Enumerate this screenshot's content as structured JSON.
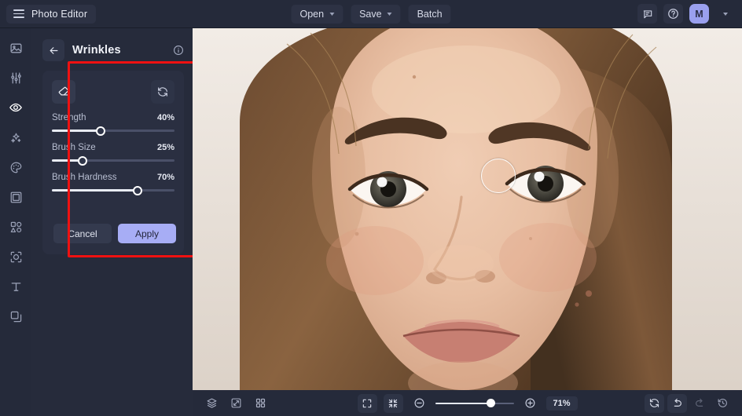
{
  "app": {
    "title": "Photo Editor",
    "menu_icon": "hamburger-icon"
  },
  "topbar": {
    "open_label": "Open",
    "save_label": "Save",
    "batch_label": "Batch",
    "feedback_icon": "comment-icon",
    "help_icon": "question-circle-icon",
    "avatar_initial": "M",
    "account_caret_icon": "chevron-down-icon"
  },
  "rail": {
    "items": [
      {
        "name": "image-icon",
        "label": "Image",
        "active": false
      },
      {
        "name": "adjust-sliders-icon",
        "label": "Adjust",
        "active": false
      },
      {
        "name": "retouch-eye-icon",
        "label": "Retouch",
        "active": true
      },
      {
        "name": "sparkles-ai-icon",
        "label": "AI Effects",
        "active": false
      },
      {
        "name": "color-palette-icon",
        "label": "Color",
        "active": false
      },
      {
        "name": "crop-frame-icon",
        "label": "Crop",
        "active": false
      },
      {
        "name": "shapes-icon",
        "label": "Shapes",
        "active": false
      },
      {
        "name": "face-detect-icon",
        "label": "Portrait",
        "active": false
      },
      {
        "name": "text-icon",
        "label": "Text",
        "active": false
      },
      {
        "name": "layers-stack-icon",
        "label": "Layers",
        "active": false
      }
    ]
  },
  "panel": {
    "back_icon": "arrow-left-icon",
    "title": "Wrinkles",
    "info_icon": "info-circle-icon",
    "eraser_icon": "eraser-icon",
    "reset_icon": "reset-refresh-icon",
    "sliders": [
      {
        "label": "Strength",
        "value": "40%",
        "percent": 40
      },
      {
        "label": "Brush Size",
        "value": "25%",
        "percent": 25
      },
      {
        "label": "Brush Hardness",
        "value": "70%",
        "percent": 70
      }
    ],
    "cancel_label": "Cancel",
    "apply_label": "Apply",
    "highlight_color": "#ef1111"
  },
  "canvas": {
    "subject": "close-up portrait of a young woman's face",
    "brush_cursor_icon": "brush-circle-cursor"
  },
  "bottombar": {
    "left_icons": [
      {
        "name": "layers-icon",
        "label": "Layers"
      },
      {
        "name": "compare-split-icon",
        "label": "Compare"
      },
      {
        "name": "grid-view-icon",
        "label": "Grid"
      }
    ],
    "fullscreen_icon": "fullscreen-icon",
    "fit-screen_icon": "fit-to-screen-icon",
    "zoom_out_icon": "zoom-out-icon",
    "zoom_in_icon": "zoom-in-icon",
    "zoom_level": "71%",
    "zoom_percent": 71,
    "right_icons": [
      {
        "name": "reset-view-icon",
        "label": "Reset",
        "dim": false
      },
      {
        "name": "undo-icon",
        "label": "Undo",
        "dim": false
      },
      {
        "name": "redo-icon",
        "label": "Redo",
        "dim": true
      },
      {
        "name": "history-icon",
        "label": "History",
        "dim": false
      }
    ]
  },
  "colors": {
    "bg": "#1e2230",
    "chrome": "#252a3a",
    "panel": "#262b3b",
    "card": "#2a2f41",
    "accent": "#a7adf5",
    "highlight": "#ef1111"
  }
}
